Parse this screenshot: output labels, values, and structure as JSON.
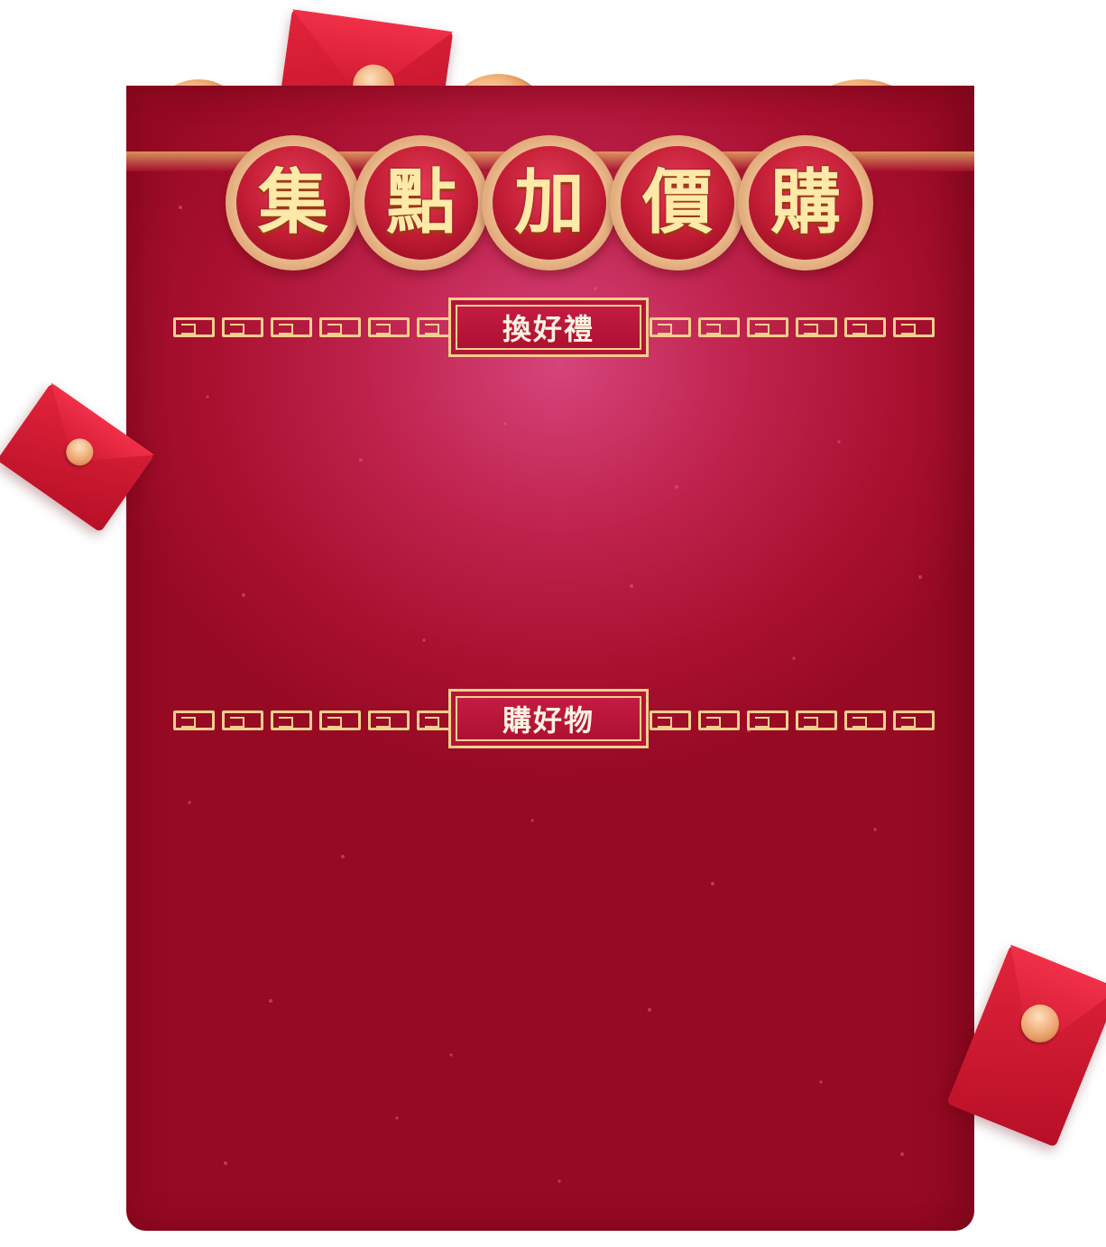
{
  "title": {
    "characters": [
      "集",
      "點",
      "加",
      "價",
      "購"
    ]
  },
  "sections": [
    {
      "label": "換好禮"
    },
    {
      "label": "購好物"
    }
  ],
  "colors": {
    "envelope": "#b3163d",
    "gold": "#f3d08c",
    "title_text": "#ffe9a8"
  }
}
